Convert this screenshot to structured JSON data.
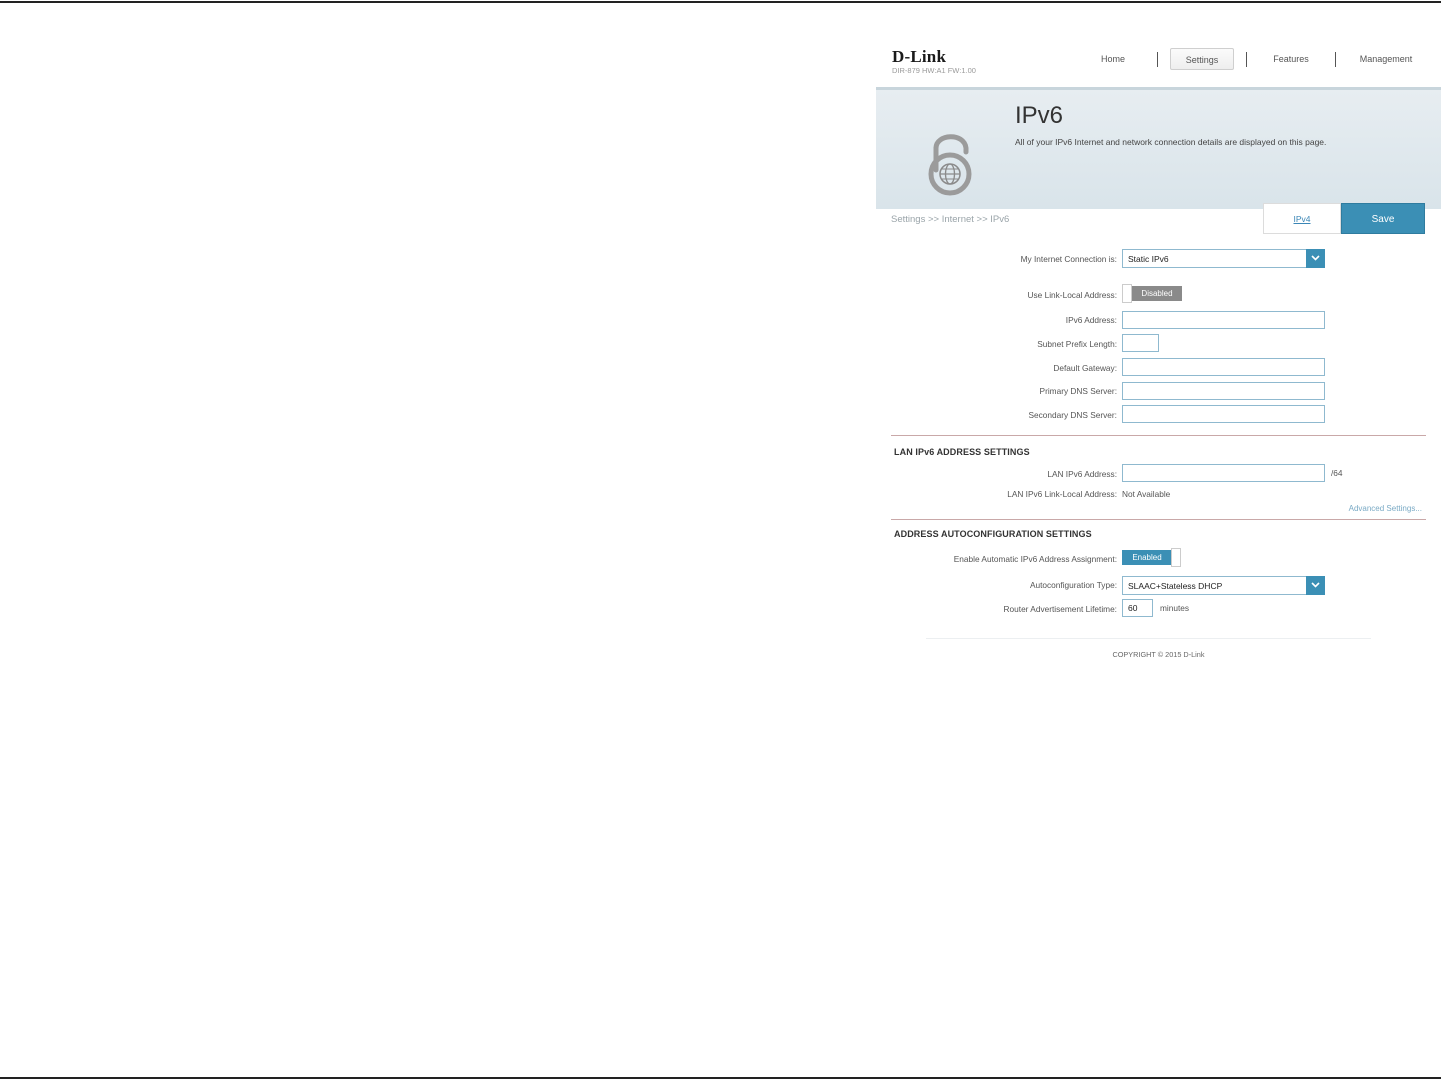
{
  "brand": {
    "name": "D-Link",
    "model": "DIR-879 HW:A1 FW:1.00"
  },
  "nav": [
    {
      "label": "Home",
      "active": false
    },
    {
      "label": "Settings",
      "active": true
    },
    {
      "label": "Features",
      "active": false
    },
    {
      "label": "Management",
      "active": false
    }
  ],
  "banner": {
    "title": "IPv6",
    "description": "All of your IPv6 Internet and network connection details are displayed on this page.",
    "icon": "lock-6-globe-icon"
  },
  "breadcrumb": "Settings >> Internet >> IPv6",
  "actions": {
    "ipv4_label": "IPv4",
    "save_label": "Save"
  },
  "form": {
    "connection_label": "My Internet Connection is:",
    "connection_value": "Static IPv6",
    "link_local_label": "Use Link-Local Address:",
    "link_local_state": "Disabled",
    "ipv6_address_label": "IPv6 Address:",
    "ipv6_address_value": "",
    "prefix_length_label": "Subnet Prefix Length:",
    "prefix_length_value": "",
    "gateway_label": "Default Gateway:",
    "gateway_value": "",
    "primary_dns_label": "Primary DNS Server:",
    "primary_dns_value": "",
    "secondary_dns_label": "Secondary DNS Server:",
    "secondary_dns_value": ""
  },
  "lan": {
    "title": "LAN IPv6 ADDRESS SETTINGS",
    "address_label": "LAN IPv6 Address:",
    "address_value": "",
    "address_suffix": "/64",
    "link_local_label": "LAN IPv6 Link-Local Address:",
    "link_local_value": "Not Available",
    "advanced_link": "Advanced Settings..."
  },
  "autoconf": {
    "title": "ADDRESS AUTOCONFIGURATION SETTINGS",
    "enable_label": "Enable Automatic IPv6 Address Assignment:",
    "enable_state": "Enabled",
    "type_label": "Autoconfiguration Type:",
    "type_value": "SLAAC+Stateless DHCP",
    "lifetime_label": "Router Advertisement Lifetime:",
    "lifetime_value": "60",
    "lifetime_unit": "minutes"
  },
  "footer": {
    "copyright": "COPYRIGHT © 2015 D-Link"
  },
  "colors": {
    "accent": "#3b8fb5",
    "toggle_off": "#8a8a8a",
    "banner_bg": "#dfe8ed"
  }
}
